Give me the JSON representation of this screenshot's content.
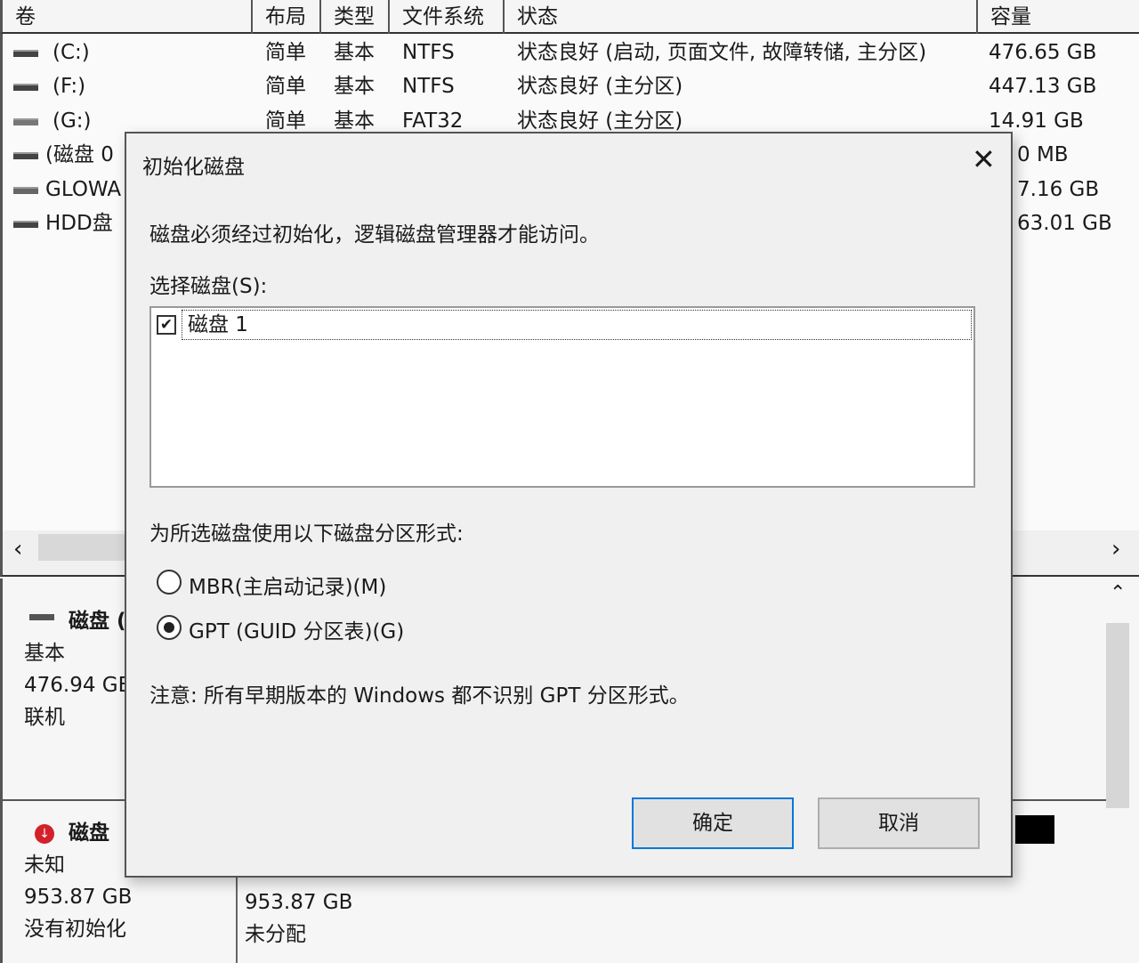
{
  "table": {
    "headers": [
      "卷",
      "布局",
      "类型",
      "文件系统",
      "状态",
      "容量"
    ],
    "rows": [
      {
        "volume": "(C:)",
        "layout": "简单",
        "type": "基本",
        "fs": "NTFS",
        "status": "状态良好 (启动, 页面文件, 故障转储, 主分区)",
        "capacity": "476.65 GB"
      },
      {
        "volume": "(F:)",
        "layout": "简单",
        "type": "基本",
        "fs": "NTFS",
        "status": "状态良好 (主分区)",
        "capacity": "447.13 GB"
      },
      {
        "volume": "(G:)",
        "layout": "简单",
        "type": "基本",
        "fs": "FAT32",
        "status": "状态良好 (主分区)",
        "capacity": "14.91 GB"
      },
      {
        "volume": "(磁盘 0",
        "capacity": "0 MB"
      },
      {
        "volume": "GLOWA",
        "capacity": "7.16 GB"
      },
      {
        "volume": "HDD盘",
        "capacity": "63.01 GB"
      }
    ]
  },
  "disks": [
    {
      "name": "磁盘 (",
      "type": "基本",
      "size": "476.94 GB",
      "status": "联机"
    },
    {
      "name": "磁盘 ",
      "type": "未知",
      "size": "953.87 GB",
      "status": "没有初始化",
      "partition_size": "953.87 GB",
      "partition_status": "未分配"
    }
  ],
  "dialog": {
    "title": "初始化磁盘",
    "message": "磁盘必须经过初始化，逻辑磁盘管理器才能访问。",
    "select_label": "选择磁盘(S):",
    "disk_item": "磁盘 1",
    "disk_checked": true,
    "style_label": "为所选磁盘使用以下磁盘分区形式:",
    "mbr": "MBR(主启动记录)(M)",
    "gpt": "GPT (GUID 分区表)(G)",
    "selected": "gpt",
    "note": "注意: 所有早期版本的 Windows 都不识别 GPT 分区形式。",
    "ok": "确定",
    "cancel": "取消"
  },
  "colors": {
    "accent": "#0078d7",
    "error": "#d4202a"
  }
}
